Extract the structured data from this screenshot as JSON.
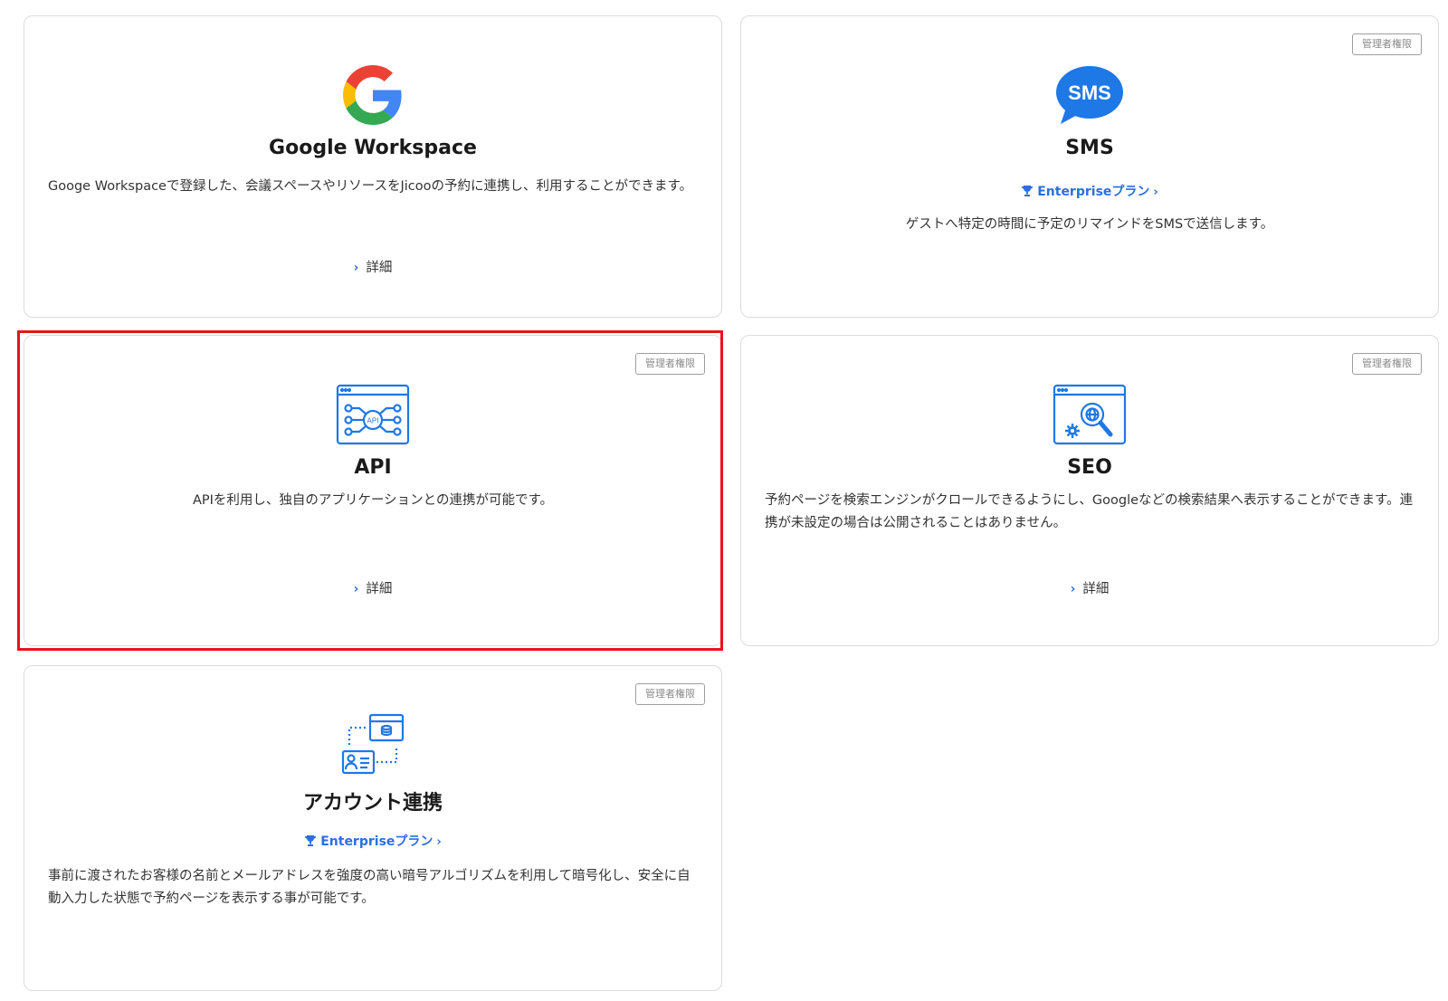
{
  "cards": {
    "google": {
      "title": "Google Workspace",
      "description": "Googe Workspaceで登録した、会議スペースやリソースをJicooの予約に連携し、利用することができます。",
      "detail_label": "詳細"
    },
    "sms": {
      "badge": "管理者権限",
      "title": "SMS",
      "icon_text": "SMS",
      "plan_label": "Enterpriseプラン",
      "description": "ゲストへ特定の時間に予定のリマインドをSMSで送信します。"
    },
    "api": {
      "badge": "管理者権限",
      "title": "API",
      "icon_text": "API",
      "description": "APIを利用し、独自のアプリケーションとの連携が可能です。",
      "detail_label": "詳細"
    },
    "seo": {
      "badge": "管理者権限",
      "title": "SEO",
      "description": "予約ページを検索エンジンがクロールできるようにし、Googleなどの検索結果へ表示することができます。連携が未設定の場合は公開されることはありません。",
      "detail_label": "詳細"
    },
    "account": {
      "badge": "管理者権限",
      "title": "アカウント連携",
      "plan_label": "Enterpriseプラン",
      "description": "事前に渡されたお客様の名前とメールアドレスを強度の高い暗号アルゴリズムを利用して暗号化し、安全に自動入力した状態で予約ページを表示する事が可能です。"
    }
  },
  "colors": {
    "accent": "#2a6fe0",
    "highlight": "#e8131b",
    "border": "#dcdcdc"
  },
  "icons": {
    "google": "google-logo-icon",
    "sms": "sms-bubble-icon",
    "api": "api-window-icon",
    "seo": "seo-globe-search-icon",
    "account": "account-link-icon",
    "plan": "trophy-icon",
    "detail": "chevron-right-icon"
  }
}
